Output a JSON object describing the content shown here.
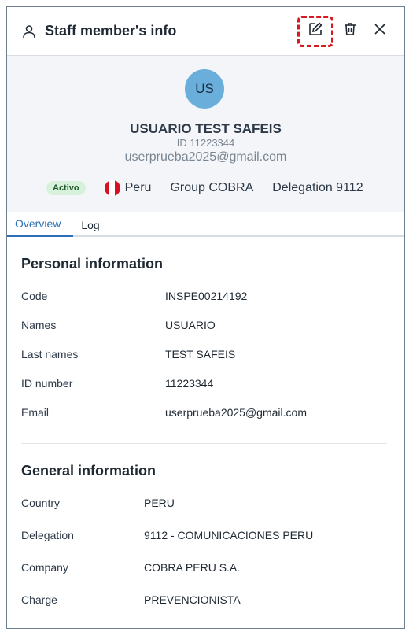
{
  "header": {
    "title": "Staff member's info",
    "icons": {
      "person": "person-icon",
      "edit": "edit-icon",
      "delete": "trash-icon",
      "close": "close-icon"
    }
  },
  "profile": {
    "initials": "US",
    "name": "USUARIO TEST SAFEIS",
    "id_line": "ID 11223344",
    "email": "userprueba2025@gmail.com",
    "status_badge": "Activo",
    "country": "Peru",
    "group": "Group COBRA",
    "delegation": "Delegation 9112"
  },
  "tabs": [
    {
      "label": "Overview",
      "active": true
    },
    {
      "label": "Log",
      "active": false
    }
  ],
  "personal": {
    "title": "Personal information",
    "rows": [
      {
        "label": "Code",
        "value": "INSPE00214192"
      },
      {
        "label": "Names",
        "value": "USUARIO"
      },
      {
        "label": "Last names",
        "value": "TEST SAFEIS"
      },
      {
        "label": "ID number",
        "value": "11223344"
      },
      {
        "label": "Email",
        "value": "userprueba2025@gmail.com"
      }
    ]
  },
  "general": {
    "title": "General information",
    "rows": [
      {
        "label": "Country",
        "value": "PERU"
      },
      {
        "label": "Delegation",
        "value": "9112 - COMUNICACIONES PERU"
      },
      {
        "label": "Company",
        "value": "COBRA PERU S.A."
      },
      {
        "label": "Charge",
        "value": "PREVENCIONISTA"
      }
    ]
  },
  "colors": {
    "accent": "#2c6fb5",
    "highlight": "#d71920",
    "avatar": "#6aaedc",
    "badge_bg": "#d8f1dc",
    "flag_red": "#d91023"
  }
}
